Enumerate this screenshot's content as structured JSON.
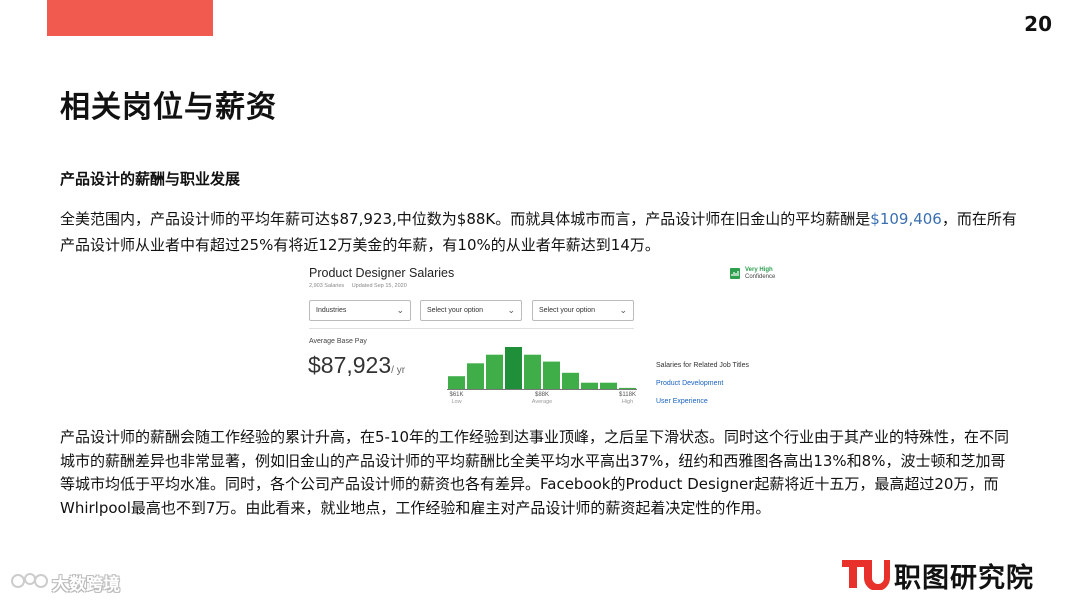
{
  "header": {
    "page_number": "20"
  },
  "title": "相关岗位与薪资",
  "subtitle": "产品设计的薪酬与职业发展",
  "paragraph1": {
    "text_a": "全美范围内，产品设计师的平均年薪可达$87,923,中位数为$88K。而就具体城市而言，产品设计师在旧金山的平均薪酬是",
    "amount": "$109,406",
    "text_b": "，而在所有产品设计师从业者中有超过25%有将近12万美金的年薪，有10%的从业者年薪达到14万。",
    "amount_color": "#3a6fb0"
  },
  "widget": {
    "title": "Product Designer Salaries",
    "salaries_count": "2,903 Salaries",
    "updated": "Updated Sep 15, 2020",
    "confidence_line1": "Very High",
    "confidence_line2": "Confidence",
    "dropdowns": [
      "Industries",
      "Select your option",
      "Select your option"
    ],
    "average_label": "Average Base Pay",
    "average_value": "$87,923",
    "average_unit": "/ yr",
    "related_title": "Salaries for Related Job Titles",
    "related_links": [
      "Product Development",
      "User Experience"
    ],
    "accent_green": "#3fae49",
    "highlight_green": "#1f8f3a",
    "link_blue": "#1861bf"
  },
  "histogram": {
    "type": "bar",
    "values": [
      0.32,
      0.62,
      0.82,
      1.0,
      0.82,
      0.66,
      0.4,
      0.17,
      0.17,
      0.05
    ],
    "highlight_index": 3,
    "ticks": [
      {
        "label": "$61K",
        "sub": "Low",
        "index": 0
      },
      {
        "label": "$88K",
        "sub": "Average",
        "index": 4.5
      },
      {
        "label": "$118K",
        "sub": "High",
        "index": 9
      }
    ]
  },
  "paragraph2": {
    "text": "产品设计师的薪酬会随工作经验的累计升高，在5-10年的工作经验到达事业顶峰，之后呈下滑状态。同时这个行业由于其产业的特殊性，在不同城市的薪酬差异也非常显著，例如旧金山的产品设计师的平均薪酬比全美平均水平高出37%，纽约和西雅图各高出13%和8%，波士顿和芝加哥等城市均低于平均水准。同时，各个公司产品设计师的薪资也各有差异。Facebook的Product Designer起薪将近十五万，最高超过20万，而Whirlpool最高也不到7万。由此看来，就业地点，工作经验和雇主对产品设计师的薪资起着决定性的作用。"
  },
  "footer": {
    "watermark_text": "大数跨境",
    "brand_text": "职图研究院",
    "brand_red": "#e8312a"
  },
  "colors": {
    "header_red": "#f05a4f"
  }
}
